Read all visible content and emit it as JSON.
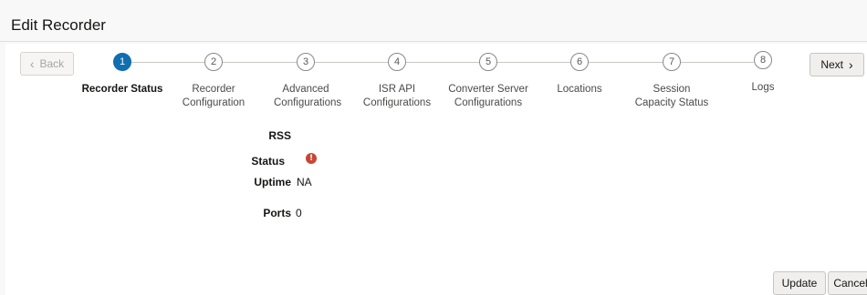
{
  "header": {
    "title": "Edit Recorder"
  },
  "nav": {
    "back_label": "Back",
    "next_label": "Next"
  },
  "train": {
    "steps": [
      {
        "number": "1",
        "label": "Recorder Status",
        "active": true
      },
      {
        "number": "2",
        "label": "Recorder Configuration"
      },
      {
        "number": "3",
        "label": "Advanced Configurations"
      },
      {
        "number": "4",
        "label": "ISR API Configurations"
      },
      {
        "number": "5",
        "label": "Converter Server Configurations"
      },
      {
        "number": "6",
        "label": "Locations"
      },
      {
        "number": "7",
        "label": "Session Capacity Status"
      },
      {
        "number": "8",
        "label": "Logs"
      }
    ]
  },
  "status": {
    "rss_label": "RSS",
    "status_label": "Status",
    "status_icon": "error-icon",
    "uptime_label": "Uptime",
    "uptime_value": "NA",
    "ports_label": "Ports",
    "ports_value": "0"
  },
  "footer": {
    "update_label": "Update",
    "cancel_label": "Cancel"
  },
  "colors": {
    "active_step": "#0f6fb0",
    "error": "#c74634"
  }
}
